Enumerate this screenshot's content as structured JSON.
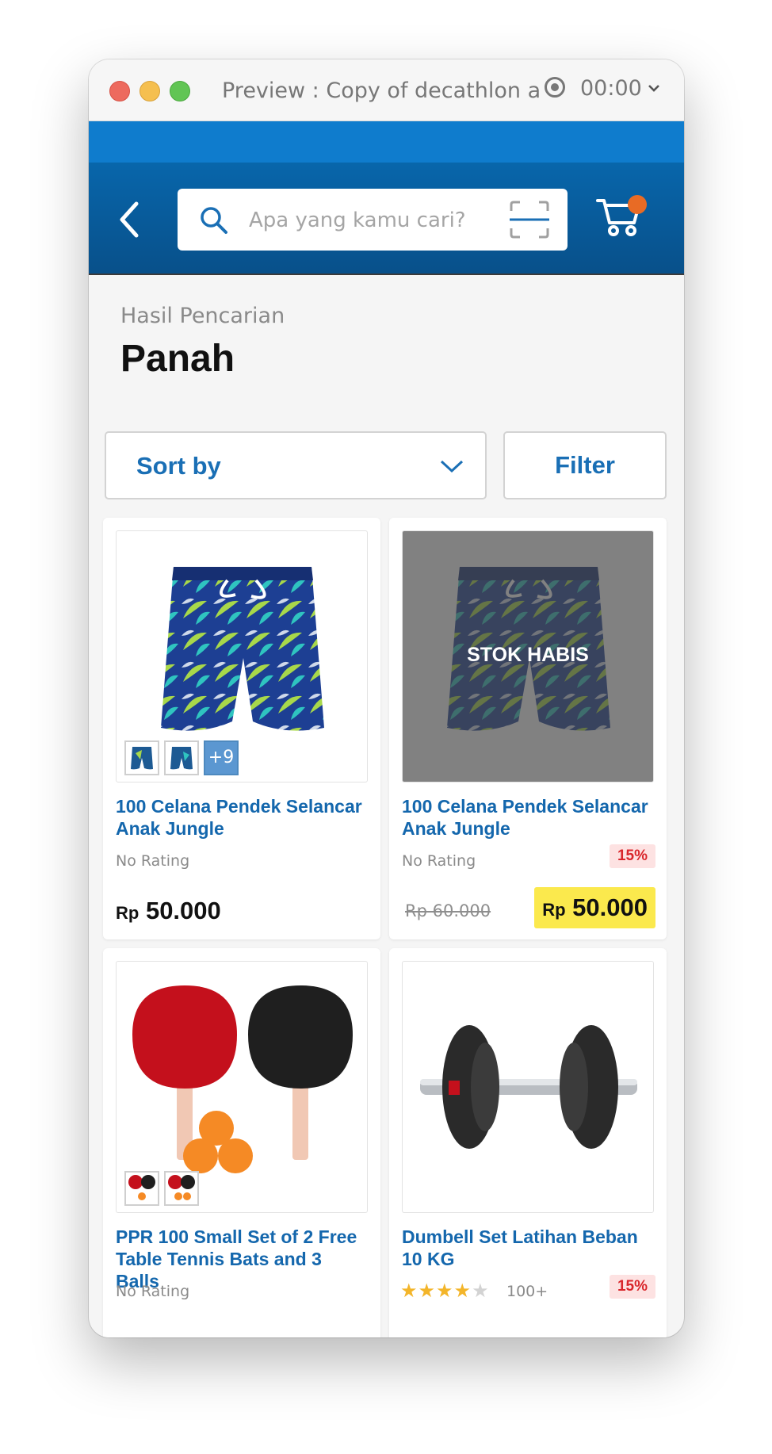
{
  "window": {
    "title": "Preview : Copy of decathlon a...",
    "timer": "00:00"
  },
  "header": {
    "search_placeholder": "Apa yang kamu cari?",
    "cart_badge_color": "#e86b25"
  },
  "search_results": {
    "subtitle": "Hasil Pencarian",
    "query": "Panah"
  },
  "toolbar": {
    "sort_label": "Sort by",
    "filter_label": "Filter"
  },
  "products": [
    {
      "name": "100 Celana Pendek Selancar Anak Jungle",
      "rating_text": "No Rating",
      "currency": "Rp",
      "price": "50.000",
      "more_thumbs": "+9"
    },
    {
      "name": "100 Celana Pendek Selancar Anak Jungle",
      "rating_text": "No Rating",
      "stock_label": "STOK HABIS",
      "discount": "15%",
      "old_price": "Rp 60.000",
      "currency": "Rp",
      "price": "50.000"
    },
    {
      "name": "PPR 100 Small Set of 2 Free Table Tennis Bats and 3 Balls",
      "rating_text": "No Rating"
    },
    {
      "name": "Dumbell Set Latihan Beban 10 KG",
      "rating": 4,
      "rating_count": "100+",
      "discount": "15%"
    }
  ],
  "colors": {
    "brand_blue": "#0866ab",
    "link_blue": "#1467ad",
    "sale_yellow": "#fbe94d",
    "discount_red": "#d9262b"
  }
}
